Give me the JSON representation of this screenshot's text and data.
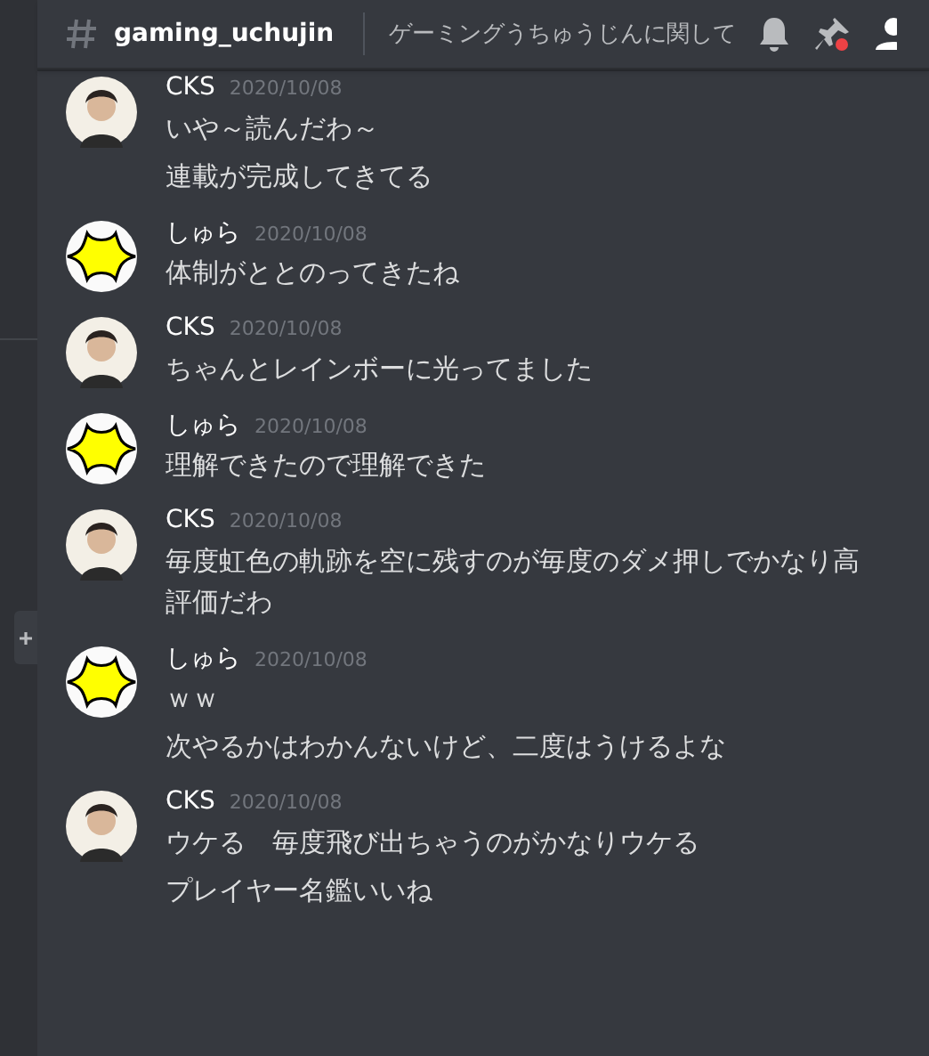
{
  "channel": {
    "name": "gaming_uchujin",
    "topic": "ゲーミングうちゅうじんに関して",
    "pins_unread": true
  },
  "messages": [
    {
      "author": "CKS",
      "kind": "person",
      "time": "2020/10/08",
      "lines": [
        "いや～読んだわ～",
        "連載が完成してきてる"
      ]
    },
    {
      "author": "しゅら",
      "kind": "star",
      "time": "2020/10/08",
      "lines": [
        "体制がととのってきたね"
      ]
    },
    {
      "author": "CKS",
      "kind": "person",
      "time": "2020/10/08",
      "lines": [
        "ちゃんとレインボーに光ってました"
      ]
    },
    {
      "author": "しゅら",
      "kind": "star",
      "time": "2020/10/08",
      "lines": [
        "理解できたので理解できた"
      ]
    },
    {
      "author": "CKS",
      "kind": "person",
      "time": "2020/10/08",
      "lines": [
        "毎度虹色の軌跡を空に残すのが毎度のダメ押しでかなり高評価だわ"
      ]
    },
    {
      "author": "しゅら",
      "kind": "star",
      "time": "2020/10/08",
      "lines": [
        "ｗｗ",
        "次やるかはわかんないけど、二度はうけるよな"
      ]
    },
    {
      "author": "CKS",
      "kind": "person",
      "time": "2020/10/08",
      "lines": [
        "ウケる　毎度飛び出ちゃうのがかなりウケる",
        "プレイヤー名鑑いいね"
      ]
    }
  ]
}
